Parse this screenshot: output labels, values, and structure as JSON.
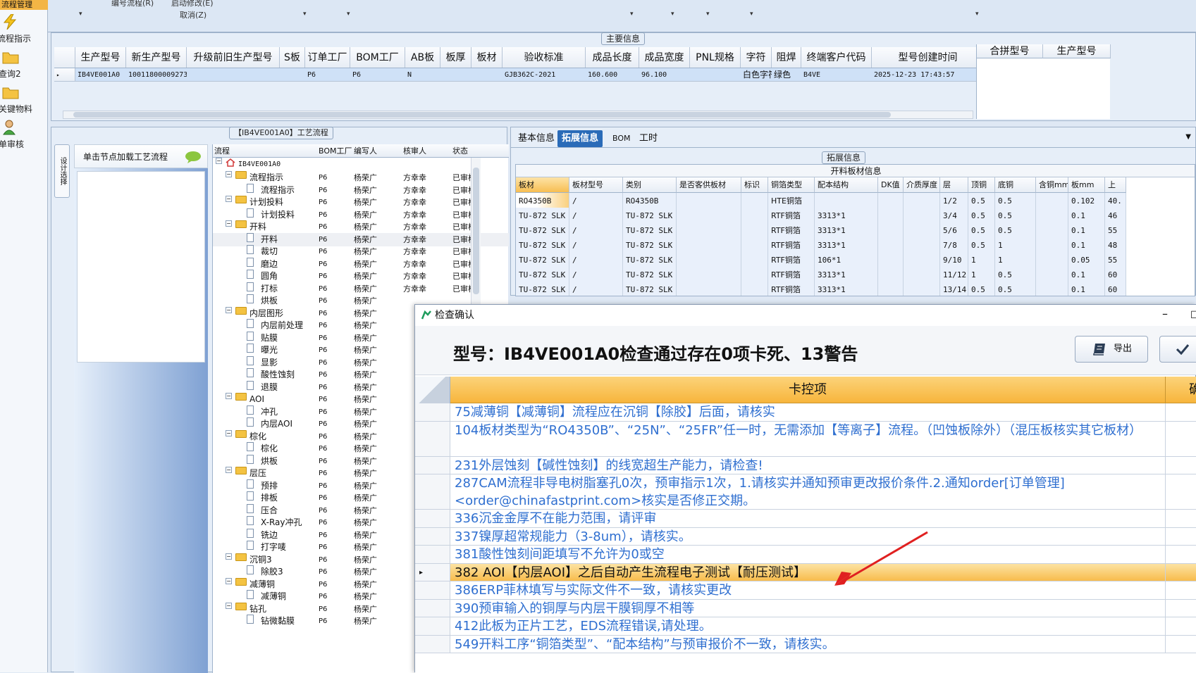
{
  "left_nav": {
    "top_item": "流程管理",
    "items": [
      {
        "label": "流程指示"
      },
      {
        "label": "查询2"
      },
      {
        "label": "关键物料"
      },
      {
        "label": "单审核"
      }
    ]
  },
  "toolbar": {
    "menu1": "编号流程(R)",
    "menu2": "启动修改(E)",
    "menu3": "取消(Z)"
  },
  "main_info": {
    "title": "主要信息",
    "columns": [
      "生产型号",
      "新生产型号",
      "升级前旧生产型号",
      "S板",
      "订单工厂",
      "BOM工厂",
      "AB板",
      "板厚",
      "板材",
      "验收标准",
      "成品长度",
      "成品宽度",
      "PNL规格",
      "字符",
      "阻焊",
      "终端客户代码",
      "型号创建时间"
    ],
    "row": [
      "IB4VE001A0",
      "10011800009273",
      "",
      "",
      "P6",
      "P6",
      "N",
      "",
      "",
      "GJB362C-2021",
      "160.600",
      "96.100",
      "",
      "白色字符",
      "绿色",
      "B4VE",
      "2025-12-23 17:43:57"
    ],
    "right_columns": [
      "合拼型号",
      "生产型号"
    ]
  },
  "process": {
    "title": "【IB4VE001A0】工艺流程",
    "vtab": "设计选择",
    "side_button": "单击节点加载工艺流程",
    "columns": [
      "流程",
      "BOM工厂",
      "编写人",
      "核审人",
      "状态"
    ],
    "root": "IB4VE001A0",
    "rows": [
      {
        "name": "流程指示",
        "type": "folder",
        "level": 1,
        "bom": "P6",
        "writer": "杨荣广",
        "reviewer": "方幸幸",
        "status": "已审核"
      },
      {
        "name": "流程指示",
        "type": "doc",
        "level": 2,
        "bom": "P6",
        "writer": "杨荣广",
        "reviewer": "方幸幸",
        "status": "已审核"
      },
      {
        "name": "计划投料",
        "type": "folder",
        "level": 1,
        "bom": "P6",
        "writer": "杨荣广",
        "reviewer": "方幸幸",
        "status": "已审核"
      },
      {
        "name": "计划投料",
        "type": "doc",
        "level": 2,
        "bom": "P6",
        "writer": "杨荣广",
        "reviewer": "方幸幸",
        "status": "已审核"
      },
      {
        "name": "开料",
        "type": "folder",
        "level": 1,
        "bom": "P6",
        "writer": "杨荣广",
        "reviewer": "方幸幸",
        "status": "已审核"
      },
      {
        "name": "开料",
        "type": "doc",
        "level": 2,
        "bom": "P6",
        "writer": "杨荣广",
        "reviewer": "方幸幸",
        "status": "已审核",
        "selected": true
      },
      {
        "name": "裁切",
        "type": "doc",
        "level": 2,
        "bom": "P6",
        "writer": "杨荣广",
        "reviewer": "方幸幸",
        "status": "已审核"
      },
      {
        "name": "磨边",
        "type": "doc",
        "level": 2,
        "bom": "P6",
        "writer": "杨荣广",
        "reviewer": "方幸幸",
        "status": "已审核"
      },
      {
        "name": "圆角",
        "type": "doc",
        "level": 2,
        "bom": "P6",
        "writer": "杨荣广",
        "reviewer": "方幸幸",
        "status": "已审核"
      },
      {
        "name": "打标",
        "type": "doc",
        "level": 2,
        "bom": "P6",
        "writer": "杨荣广",
        "reviewer": "方幸幸",
        "status": "已审核"
      },
      {
        "name": "烘板",
        "type": "doc",
        "level": 2,
        "bom": "P6",
        "writer": "杨荣广",
        "reviewer": "",
        "status": ""
      },
      {
        "name": "内层图形",
        "type": "folder",
        "level": 1,
        "bom": "P6",
        "writer": "杨荣广",
        "reviewer": "",
        "status": ""
      },
      {
        "name": "内层前处理",
        "type": "doc",
        "level": 2,
        "bom": "P6",
        "writer": "杨荣广",
        "reviewer": "",
        "status": ""
      },
      {
        "name": "贴膜",
        "type": "doc",
        "level": 2,
        "bom": "P6",
        "writer": "杨荣广",
        "reviewer": "",
        "status": ""
      },
      {
        "name": "曝光",
        "type": "doc",
        "level": 2,
        "bom": "P6",
        "writer": "杨荣广",
        "reviewer": "",
        "status": ""
      },
      {
        "name": "显影",
        "type": "doc",
        "level": 2,
        "bom": "P6",
        "writer": "杨荣广",
        "reviewer": "",
        "status": ""
      },
      {
        "name": "酸性蚀刻",
        "type": "doc",
        "level": 2,
        "bom": "P6",
        "writer": "杨荣广",
        "reviewer": "",
        "status": ""
      },
      {
        "name": "退膜",
        "type": "doc",
        "level": 2,
        "bom": "P6",
        "writer": "杨荣广",
        "reviewer": "",
        "status": ""
      },
      {
        "name": "AOI",
        "type": "folder",
        "level": 1,
        "bom": "P6",
        "writer": "杨荣广",
        "reviewer": "",
        "status": ""
      },
      {
        "name": "冲孔",
        "type": "doc",
        "level": 2,
        "bom": "P6",
        "writer": "杨荣广",
        "reviewer": "",
        "status": ""
      },
      {
        "name": "内层AOI",
        "type": "doc",
        "level": 2,
        "bom": "P6",
        "writer": "杨荣广",
        "reviewer": "",
        "status": ""
      },
      {
        "name": "棕化",
        "type": "folder",
        "level": 1,
        "bom": "P6",
        "writer": "杨荣广",
        "reviewer": "",
        "status": ""
      },
      {
        "name": "棕化",
        "type": "doc",
        "level": 2,
        "bom": "P6",
        "writer": "杨荣广",
        "reviewer": "",
        "status": ""
      },
      {
        "name": "烘板",
        "type": "doc",
        "level": 2,
        "bom": "P6",
        "writer": "杨荣广",
        "reviewer": "",
        "status": ""
      },
      {
        "name": "层压",
        "type": "folder",
        "level": 1,
        "bom": "P6",
        "writer": "杨荣广",
        "reviewer": "",
        "status": ""
      },
      {
        "name": "预排",
        "type": "doc",
        "level": 2,
        "bom": "P6",
        "writer": "杨荣广",
        "reviewer": "",
        "status": ""
      },
      {
        "name": "排板",
        "type": "doc",
        "level": 2,
        "bom": "P6",
        "writer": "杨荣广",
        "reviewer": "",
        "status": ""
      },
      {
        "name": "压合",
        "type": "doc",
        "level": 2,
        "bom": "P6",
        "writer": "杨荣广",
        "reviewer": "",
        "status": ""
      },
      {
        "name": "X-Ray冲孔",
        "type": "doc",
        "level": 2,
        "bom": "P6",
        "writer": "杨荣广",
        "reviewer": "",
        "status": ""
      },
      {
        "name": "铣边",
        "type": "doc",
        "level": 2,
        "bom": "P6",
        "writer": "杨荣广",
        "reviewer": "",
        "status": ""
      },
      {
        "name": "打字唛",
        "type": "doc",
        "level": 2,
        "bom": "P6",
        "writer": "杨荣广",
        "reviewer": "",
        "status": ""
      },
      {
        "name": "沉铜3",
        "type": "folder",
        "level": 1,
        "bom": "P6",
        "writer": "杨荣广",
        "reviewer": "",
        "status": ""
      },
      {
        "name": "除胶3",
        "type": "doc",
        "level": 2,
        "bom": "P6",
        "writer": "杨荣广",
        "reviewer": "",
        "status": ""
      },
      {
        "name": "减薄铜",
        "type": "folder",
        "level": 1,
        "bom": "P6",
        "writer": "杨荣广",
        "reviewer": "",
        "status": ""
      },
      {
        "name": "减薄铜",
        "type": "doc",
        "level": 2,
        "bom": "P6",
        "writer": "杨荣广",
        "reviewer": "",
        "status": ""
      },
      {
        "name": "钻孔",
        "type": "folder",
        "level": 1,
        "bom": "P6",
        "writer": "杨荣广",
        "reviewer": "",
        "status": ""
      },
      {
        "name": "钻微黏膜",
        "type": "doc",
        "level": 2,
        "bom": "P6",
        "writer": "杨荣广",
        "reviewer": "",
        "status": ""
      }
    ]
  },
  "ext": {
    "tabs": [
      "基本信息",
      "拓展信息",
      "BOM",
      "工时"
    ],
    "active_tab": "拓展信息",
    "section_title": "拓展信息",
    "caption": "开料板材信息",
    "columns": [
      "板材",
      "板材型号",
      "类别",
      "是否客供板材",
      "标识",
      "铜箔类型",
      "配本结构",
      "DK值",
      "介质厚度",
      "层",
      "顶铜",
      "底铜",
      "含铜mm",
      "板mm",
      "上"
    ],
    "rows": [
      [
        "RO4350B",
        "/",
        "RO4350B",
        "",
        "",
        "HTE铜箔",
        "",
        "",
        "",
        "1/2",
        "0.5",
        "0.5",
        "",
        "0.102",
        "40."
      ],
      [
        "TU-872 SLK",
        "/",
        "TU-872 SLK",
        "",
        "",
        "RTF铜箔",
        "3313*1",
        "",
        "",
        "3/4",
        "0.5",
        "0.5",
        "",
        "0.1",
        "46"
      ],
      [
        "TU-872 SLK",
        "/",
        "TU-872 SLK",
        "",
        "",
        "RTF铜箔",
        "3313*1",
        "",
        "",
        "5/6",
        "0.5",
        "0.5",
        "",
        "0.1",
        "55"
      ],
      [
        "TU-872 SLK",
        "/",
        "TU-872 SLK",
        "",
        "",
        "RTF铜箔",
        "3313*1",
        "",
        "",
        "7/8",
        "0.5",
        "1",
        "",
        "0.1",
        "48"
      ],
      [
        "TU-872 SLK",
        "/",
        "TU-872 SLK",
        "",
        "",
        "RTF铜箔",
        "106*1",
        "",
        "",
        "9/10",
        "1",
        "1",
        "",
        "0.05",
        "55"
      ],
      [
        "TU-872 SLK",
        "/",
        "TU-872 SLK",
        "",
        "",
        "RTF铜箔",
        "3313*1",
        "",
        "",
        "11/12",
        "1",
        "0.5",
        "",
        "0.1",
        "60"
      ],
      [
        "TU-872 SLK",
        "/",
        "TU-872 SLK",
        "",
        "",
        "RTF铜箔",
        "3313*1",
        "",
        "",
        "13/14",
        "0.5",
        "0.5",
        "",
        "0.1",
        "60"
      ]
    ]
  },
  "dialog": {
    "title": "检查确认",
    "heading": "型号：IB4VE001A0检查通过存在0项卡死、13警告",
    "export_label": "导出",
    "column": "卡控项",
    "column2": "确",
    "rows": [
      {
        "text": "75减薄铜【减薄铜】流程应在沉铜【除胶】后面，请核实",
        "lines": 1
      },
      {
        "text": "104板材类型为“RO4350B”、“25N”、“25FR”任一时，无需添加【等离子】流程。（凹蚀板除外）（混压板核实其它板材）",
        "lines": 2
      },
      {
        "text": "231外层蚀刻【碱性蚀刻】的线宽超生产能力，请检查!",
        "lines": 1
      },
      {
        "text": "287CAM流程非导电树脂塞孔0次，预审指示1次，1.请核实并通知预审更改报价条件.2.通知order[订单管理]<order@chinafastprint.com>核实是否修正交期。",
        "lines": 2
      },
      {
        "text": "336沉金金厚不在能力范围，请评审",
        "lines": 1
      },
      {
        "text": "337镍厚超常规能力（3-8um），请核实。",
        "lines": 1
      },
      {
        "text": "381酸性蚀刻间距填写不允许为0或空",
        "lines": 1
      },
      {
        "text": "382 AOI【内层AOI】之后自动产生流程电子测试【耐压测试】",
        "lines": 1,
        "selected": true
      },
      {
        "text": "386ERP菲林填写与实际文件不一致，请核实更改",
        "lines": 1
      },
      {
        "text": "390预审输入的铜厚与内层干膜铜厚不相等",
        "lines": 1
      },
      {
        "text": "412此板为正片工艺，EDS流程错误,请处理。",
        "lines": 1
      },
      {
        "text": "549开料工序“铜箔类型”、“配本结构”与预审报价不一致，请核实。",
        "lines": 1
      }
    ]
  },
  "colors": {
    "accent": "#2a6bb8",
    "highlight": "#f7b53c",
    "link_text": "#2f6fd0",
    "arrow": "#e02020"
  }
}
